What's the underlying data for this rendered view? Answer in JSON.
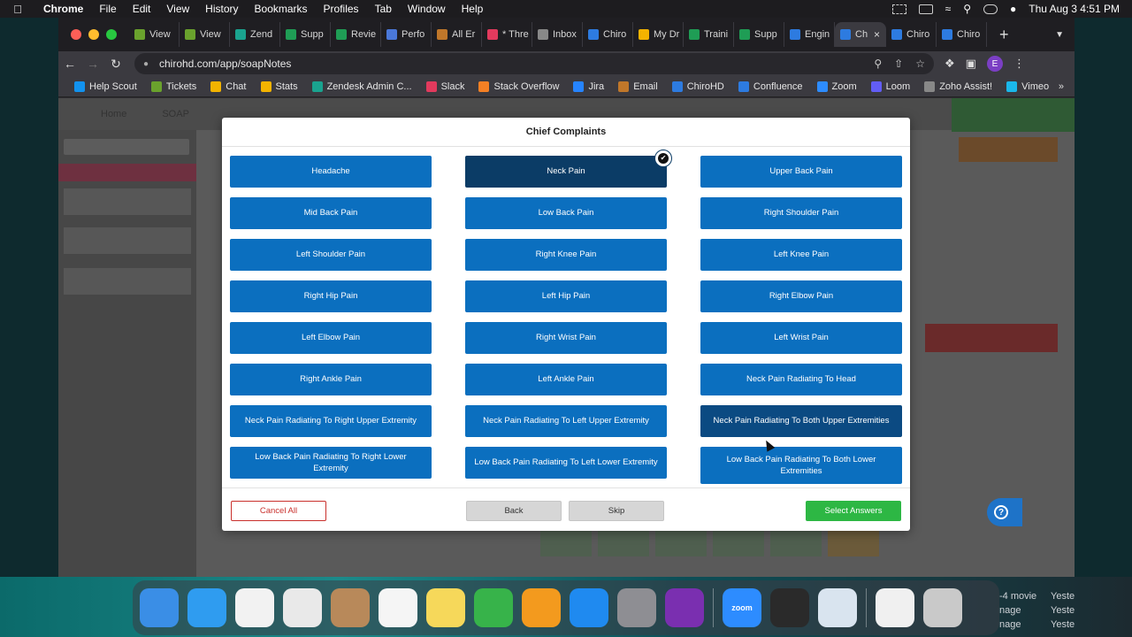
{
  "menubar": {
    "items": [
      "Chrome",
      "File",
      "Edit",
      "View",
      "History",
      "Bookmarks",
      "Profiles",
      "Tab",
      "Window",
      "Help"
    ],
    "clock": "Thu Aug 3  4:51 PM"
  },
  "browser": {
    "tabs": [
      {
        "label": "View",
        "color": "#6aa22d"
      },
      {
        "label": "View",
        "color": "#6aa22d"
      },
      {
        "label": "Zend",
        "color": "#1aa38f"
      },
      {
        "label": "Supp",
        "color": "#1f9d55"
      },
      {
        "label": "Revie",
        "color": "#1f9d55"
      },
      {
        "label": "Perfo",
        "color": "#4a78d9"
      },
      {
        "label": "All Er",
        "color": "#c0772a"
      },
      {
        "label": "* Thre",
        "color": "#e23a5d"
      },
      {
        "label": "Inbox",
        "color": "#888"
      },
      {
        "label": "Chiro",
        "color": "#2d7be0"
      },
      {
        "label": "My Dr",
        "color": "#f3b300"
      },
      {
        "label": "Traini",
        "color": "#1f9d55"
      },
      {
        "label": "Supp",
        "color": "#1f9d55"
      },
      {
        "label": "Engin",
        "color": "#2d7be0"
      },
      {
        "label": "Ch",
        "color": "#2d7be0",
        "active": true
      },
      {
        "label": "Chiro",
        "color": "#2d7be0"
      },
      {
        "label": "Chiro",
        "color": "#2d7be0"
      }
    ],
    "url": "chirohd.com/app/soapNotes",
    "profile_initial": "E",
    "bookmarks": [
      {
        "label": "Help Scout",
        "color": "#1292ee"
      },
      {
        "label": "Tickets",
        "color": "#6aa22d"
      },
      {
        "label": "Chat",
        "color": "#f3b300"
      },
      {
        "label": "Stats",
        "color": "#f3b300"
      },
      {
        "label": "Zendesk Admin C...",
        "color": "#1aa38f"
      },
      {
        "label": "Slack",
        "color": "#e23a5d"
      },
      {
        "label": "Stack Overflow",
        "color": "#f48024"
      },
      {
        "label": "Jira",
        "color": "#2684ff"
      },
      {
        "label": "Email",
        "color": "#c0772a"
      },
      {
        "label": "ChiroHD",
        "color": "#2d7be0"
      },
      {
        "label": "Confluence",
        "color": "#2d7be0"
      },
      {
        "label": "Zoom",
        "color": "#2d8cff"
      },
      {
        "label": "Loom",
        "color": "#625df5"
      },
      {
        "label": "Zoho Assist!",
        "color": "#888"
      },
      {
        "label": "Vimeo",
        "color": "#1ab7ea"
      }
    ]
  },
  "app": {
    "nav": [
      "Home",
      "SOAP"
    ]
  },
  "modal": {
    "title": "Chief Complaints",
    "complaints": [
      {
        "label": "Headache",
        "state": "normal"
      },
      {
        "label": "Neck Pain",
        "state": "selected"
      },
      {
        "label": "Upper Back Pain",
        "state": "normal"
      },
      {
        "label": "Mid Back Pain",
        "state": "normal"
      },
      {
        "label": "Low Back Pain",
        "state": "normal"
      },
      {
        "label": "Right Shoulder Pain",
        "state": "normal"
      },
      {
        "label": "Left Shoulder Pain",
        "state": "normal"
      },
      {
        "label": "Right Knee Pain",
        "state": "normal"
      },
      {
        "label": "Left Knee Pain",
        "state": "normal"
      },
      {
        "label": "Right Hip Pain",
        "state": "normal"
      },
      {
        "label": "Left Hip Pain",
        "state": "normal"
      },
      {
        "label": "Right Elbow Pain",
        "state": "normal"
      },
      {
        "label": "Left Elbow Pain",
        "state": "normal"
      },
      {
        "label": "Right Wrist Pain",
        "state": "normal"
      },
      {
        "label": "Left Wrist Pain",
        "state": "normal"
      },
      {
        "label": "Right Ankle Pain",
        "state": "normal"
      },
      {
        "label": "Left Ankle Pain",
        "state": "normal"
      },
      {
        "label": "Neck Pain Radiating To Head",
        "state": "normal"
      },
      {
        "label": "Neck Pain Radiating To Right Upper Extremity",
        "state": "normal"
      },
      {
        "label": "Neck Pain Radiating To Left Upper Extremity",
        "state": "normal"
      },
      {
        "label": "Neck Pain Radiating To Both Upper Extremities",
        "state": "hover"
      },
      {
        "label": "Low Back Pain Radiating To Right Lower Extremity",
        "state": "normal"
      },
      {
        "label": "Low Back Pain Radiating To Left Lower Extremity",
        "state": "normal"
      },
      {
        "label": "Low Back Pain Radiating To Both Lower Extremities",
        "state": "normal"
      }
    ],
    "buttons": {
      "cancel": "Cancel All",
      "back": "Back",
      "skip": "Skip",
      "select": "Select Answers"
    }
  },
  "dock": {
    "apps": [
      {
        "name": "finder-icon",
        "color": "#3a8ee6",
        "label": ""
      },
      {
        "name": "safari-icon",
        "color": "#2f9cf0",
        "label": ""
      },
      {
        "name": "photos-icon",
        "color": "#f2f2f2",
        "label": ""
      },
      {
        "name": "chrome-icon",
        "color": "#e9e9e9",
        "label": ""
      },
      {
        "name": "contacts-icon",
        "color": "#b8895a",
        "label": ""
      },
      {
        "name": "reminders-icon",
        "color": "#f5f5f5",
        "label": ""
      },
      {
        "name": "notes-icon",
        "color": "#f6d85a",
        "label": ""
      },
      {
        "name": "numbers-icon",
        "color": "#37b34a",
        "label": ""
      },
      {
        "name": "pages-icon",
        "color": "#f39a1e",
        "label": ""
      },
      {
        "name": "app-store-icon",
        "color": "#1f8af0",
        "label": ""
      },
      {
        "name": "system-settings-icon",
        "color": "#8e8e93",
        "label": ""
      },
      {
        "name": "screen-recorder-icon",
        "color": "#7a2fb0",
        "label": ""
      },
      {
        "name": "zoom-icon",
        "color": "#2d8cff",
        "label": "zoom"
      },
      {
        "name": "quicktime-icon",
        "color": "#2a2a2a",
        "label": ""
      },
      {
        "name": "preview-icon",
        "color": "#d9e4ef",
        "label": ""
      },
      {
        "name": "document-icon",
        "color": "#f0f0f0",
        "label": ""
      },
      {
        "name": "trash-icon",
        "color": "#c9c9c9",
        "label": ""
      }
    ],
    "finder_side": [
      "-4 movie",
      "nage",
      "nage"
    ],
    "finder_side2": [
      "Yeste",
      "Yeste",
      "Yeste"
    ]
  }
}
